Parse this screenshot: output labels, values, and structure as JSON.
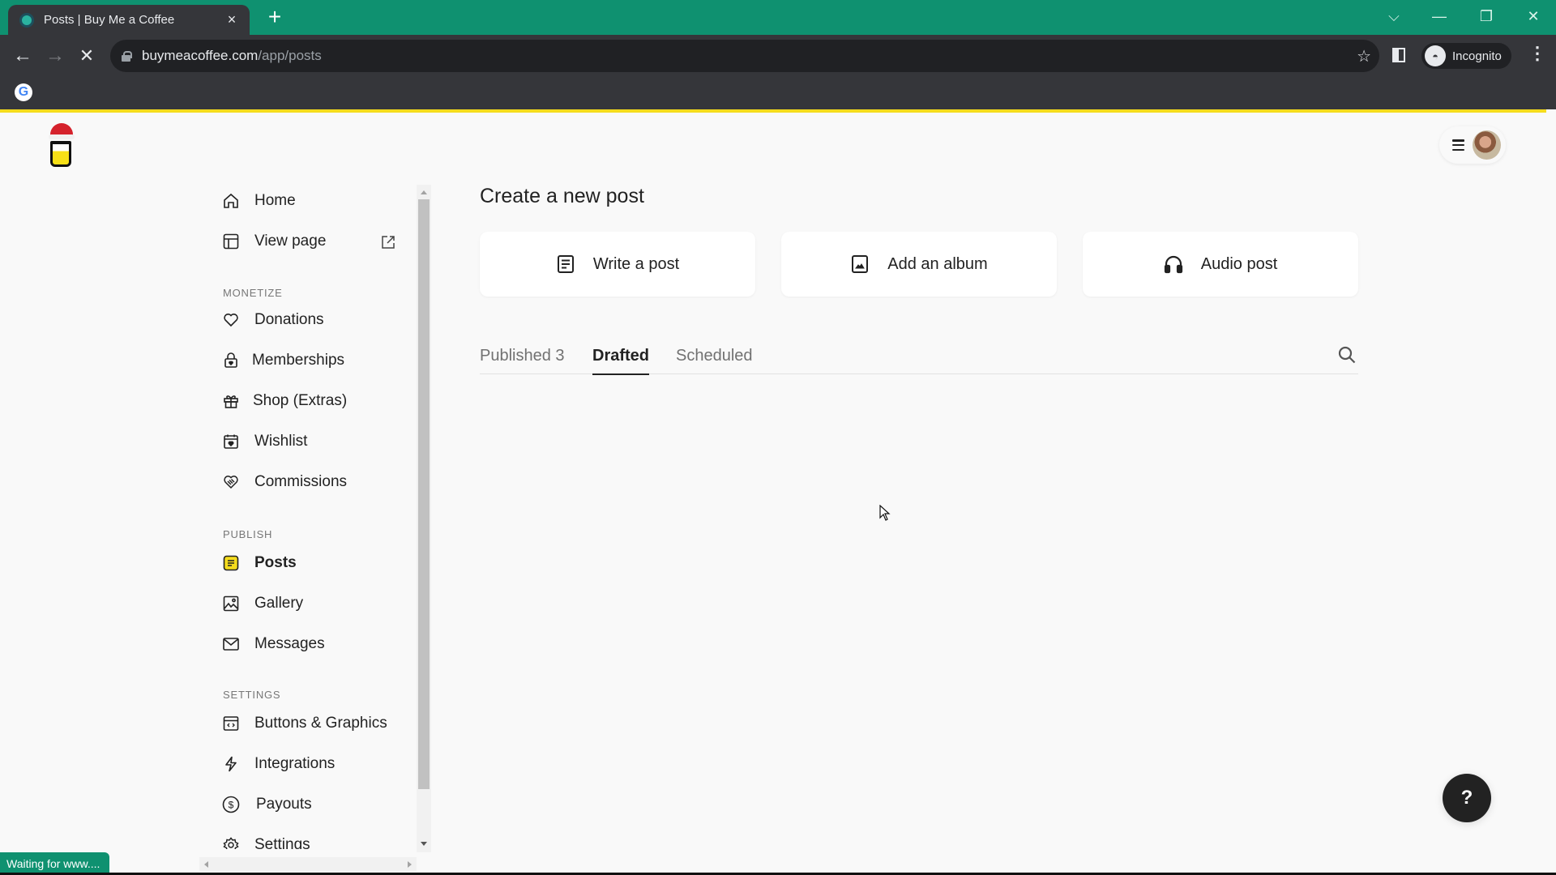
{
  "browser": {
    "tab_title": "Posts | Buy Me a Coffee",
    "tab_close": "×",
    "new_tab": "+",
    "url_host": "buymeacoffee.com",
    "url_path": "/app/posts",
    "profile_label": "Incognito",
    "status_text": "Waiting for www....",
    "window_controls": {
      "tab_search": "⌵",
      "minimize": "—",
      "restore": "❐",
      "close": "✕"
    },
    "nav": {
      "back": "←",
      "forward": "→",
      "stop": "✕"
    },
    "bookmark_star": "☆",
    "menu": "⋮"
  },
  "header": {
    "brand_colors": {
      "accent": "#f5dc1d",
      "chrome_green": "#0f9170"
    }
  },
  "sidebar": {
    "top_items": [
      {
        "label": "Home",
        "icon": "home-icon"
      },
      {
        "label": "View page",
        "icon": "layout-icon",
        "trailing_icon": "external-link-icon"
      }
    ],
    "sections": [
      {
        "title": "MONETIZE",
        "items": [
          {
            "label": "Donations",
            "icon": "heart-icon"
          },
          {
            "label": "Memberships",
            "icon": "lock-icon"
          },
          {
            "label": "Shop (Extras)",
            "icon": "gift-icon"
          },
          {
            "label": "Wishlist",
            "icon": "calendar-heart-icon"
          },
          {
            "label": "Commissions",
            "icon": "handshake-icon"
          }
        ]
      },
      {
        "title": "PUBLISH",
        "items": [
          {
            "label": "Posts",
            "icon": "posts-icon",
            "active": true
          },
          {
            "label": "Gallery",
            "icon": "gallery-icon"
          },
          {
            "label": "Messages",
            "icon": "mail-icon"
          }
        ]
      },
      {
        "title": "SETTINGS",
        "items": [
          {
            "label": "Buttons & Graphics",
            "icon": "code-window-icon"
          },
          {
            "label": "Integrations",
            "icon": "lightning-icon"
          },
          {
            "label": "Payouts",
            "icon": "dollar-circle-icon"
          },
          {
            "label": "Settings",
            "icon": "gear-icon"
          }
        ]
      }
    ]
  },
  "main": {
    "title": "Create a new post",
    "create_options": [
      {
        "label": "Write a post",
        "icon": "document-icon"
      },
      {
        "label": "Add an album",
        "icon": "image-icon"
      },
      {
        "label": "Audio post",
        "icon": "headphones-icon"
      }
    ],
    "tabs": [
      {
        "label": "Published 3",
        "active": false
      },
      {
        "label": "Drafted",
        "active": true
      },
      {
        "label": "Scheduled",
        "active": false
      }
    ]
  },
  "help": {
    "label": "?"
  }
}
